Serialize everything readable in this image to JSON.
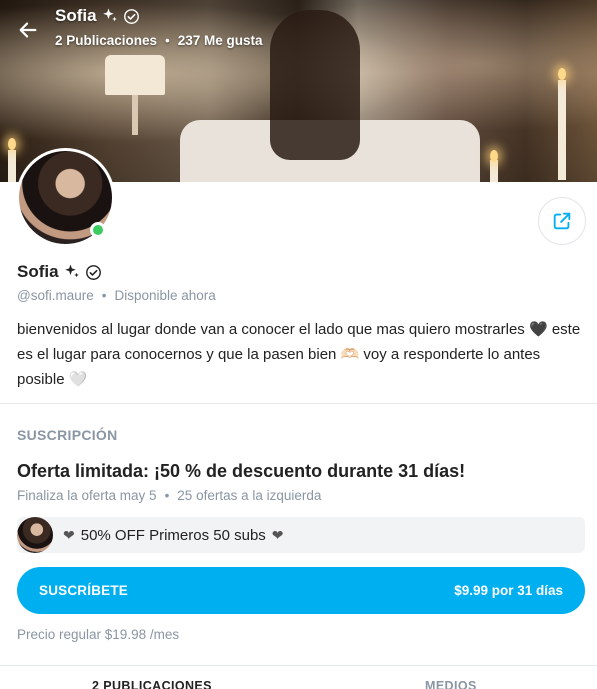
{
  "header": {
    "name": "Sofia",
    "posts": "2 Publicaciones",
    "likes": "237 Me gusta"
  },
  "profile": {
    "name": "Sofia",
    "handle": "@sofi.maure",
    "status": "Disponible ahora",
    "bio": "bienvenidos al lugar donde van a conocer el lado que mas quiero mostrarles 🖤 este es el lugar para conocernos y que la pasen bien 🫶🏻 voy a responderte lo antes posible 🤍",
    "online_color": "#3ccb5e"
  },
  "subscription": {
    "section_title": "SUSCRIPCIÓN",
    "offer_title": "Oferta limitada: ¡50 % de descuento durante 31 días!",
    "offer_ends": "Finaliza la oferta may 5",
    "offers_left": "25 ofertas a la izquierda",
    "promo_text": "50% OFF Primeros 50 subs",
    "subscribe_label": "SUSCRÍBETE",
    "subscribe_price": "$9.99 por 31 días",
    "regular_price": "Precio regular $19.98 /mes",
    "accent_color": "#00aff0"
  },
  "tabs": [
    {
      "label": "2 PUBLICACIONES"
    },
    {
      "label": "MEDIOS"
    }
  ],
  "icons": {
    "back": "arrow-left-icon",
    "sparkle": "sparkles-icon",
    "verified": "verified-badge-icon",
    "share": "share-icon",
    "heart": "black-heart-icon"
  }
}
